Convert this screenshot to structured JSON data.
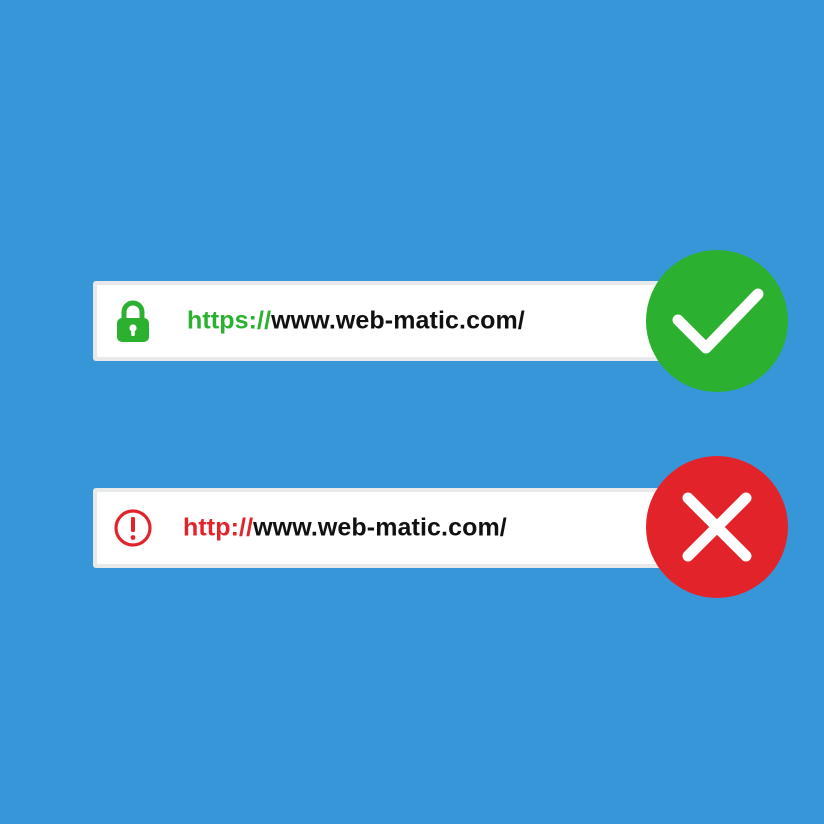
{
  "colors": {
    "background": "#3796d8",
    "secure": "#2bb02f",
    "insecure": "#e3232a",
    "text": "#111111"
  },
  "secure_bar": {
    "icon": "lock-icon",
    "protocol": "https://",
    "domain": "www.web-matic.com/",
    "badge_icon": "checkmark-icon"
  },
  "insecure_bar": {
    "icon": "warning-circle-icon",
    "protocol": "http://",
    "domain": "www.web-matic.com/",
    "badge_icon": "cross-icon"
  }
}
